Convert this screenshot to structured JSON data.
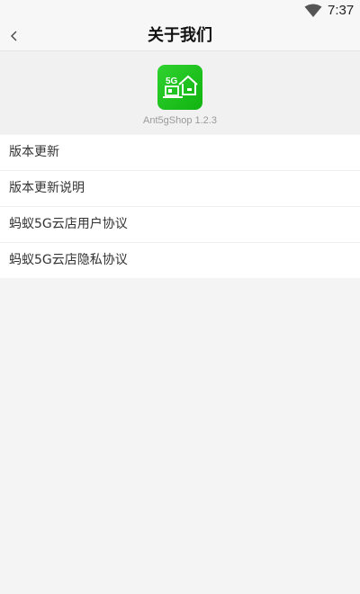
{
  "status_bar": {
    "time": "7:37",
    "wifi_icon": "wifi-icon"
  },
  "nav": {
    "back_icon": "chevron-left-icon",
    "title": "关于我们"
  },
  "app": {
    "icon": "app-logo-icon",
    "logo_text": "5G",
    "version_label": "Ant5gShop 1.2.3"
  },
  "menu": {
    "items": [
      {
        "label": "版本更新"
      },
      {
        "label": "版本更新说明"
      },
      {
        "label": "蚂蚁5G云店用户协议"
      },
      {
        "label": "蚂蚁5G云店隐私协议"
      }
    ]
  },
  "colors": {
    "app_icon_green": "#1cc21c",
    "background": "#f4f4f4"
  }
}
